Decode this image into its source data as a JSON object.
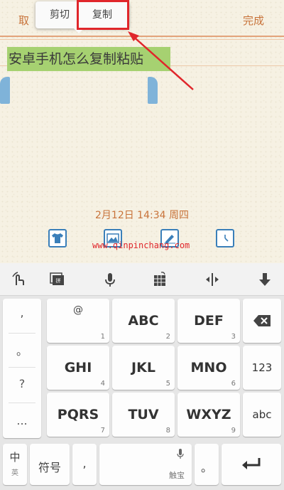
{
  "header": {
    "cancel_label": "取",
    "done_label": "完成"
  },
  "popup": {
    "cut_label": "剪切",
    "copy_label": "复制"
  },
  "note": {
    "selected_text": "安卓手机怎么复制粘贴",
    "date": "2月12日 14:34 周四"
  },
  "watermark": "www.qinpinchang.com",
  "colors": {
    "accent": "#c8733a",
    "selection": "#a6d171",
    "handle": "#7fb3d9",
    "highlight": "#e0262b"
  },
  "toolbar_icons": [
    "shirt-icon",
    "image-icon",
    "edit-icon",
    "clock-icon"
  ],
  "keyboard": {
    "toolbar": [
      "handwriting-icon",
      "keyboard-switch-icon",
      "mic-icon",
      "grid-icon",
      "cursor-move-icon",
      "hide-keyboard-icon"
    ],
    "left_column": [
      ",",
      "。",
      "?",
      "..."
    ],
    "rows": [
      [
        {
          "main": "@",
          "sub": "1"
        },
        {
          "main": "ABC",
          "sub": "2"
        },
        {
          "main": "DEF",
          "sub": "3"
        }
      ],
      [
        {
          "main": "GHI",
          "sub": "4"
        },
        {
          "main": "JKL",
          "sub": "5"
        },
        {
          "main": "MNO",
          "sub": "6"
        }
      ],
      [
        {
          "main": "PQRS",
          "sub": "7"
        },
        {
          "main": "TUV",
          "sub": "8"
        },
        {
          "main": "WXYZ",
          "sub": "9"
        }
      ]
    ],
    "right_keys": {
      "num": "123",
      "abc": "abc"
    },
    "bottom": {
      "lang_main": "中",
      "lang_sub": "英",
      "symbol": "符号",
      "comma": ",",
      "space_sub": "触宝",
      "period": "。"
    }
  }
}
